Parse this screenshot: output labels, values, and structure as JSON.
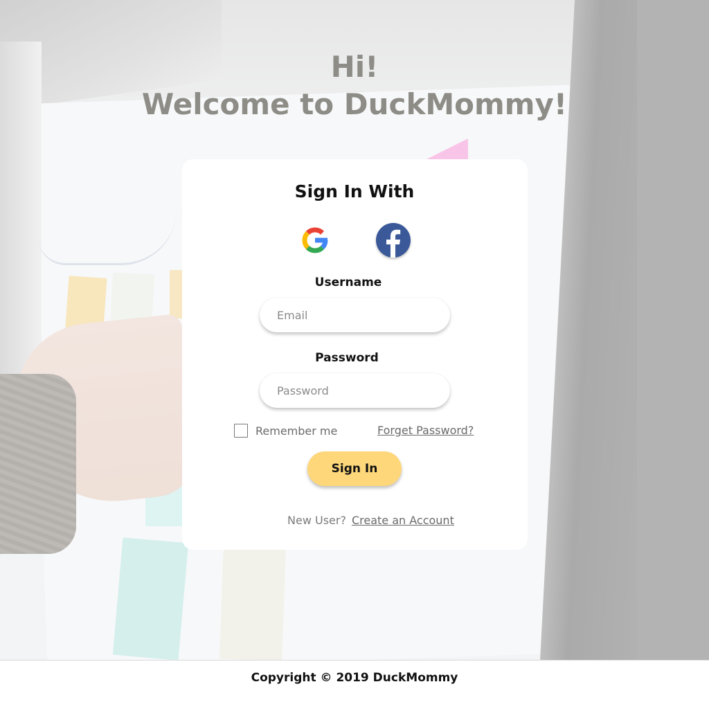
{
  "headline": {
    "line1": "Hi!",
    "line2": "Welcome to DuckMommy!"
  },
  "card": {
    "title": "Sign In With",
    "social": [
      {
        "name": "Google",
        "icon": "google-icon"
      },
      {
        "name": "Facebook",
        "icon": "facebook-icon",
        "color": "#3b5998"
      }
    ],
    "username_label": "Username",
    "email_placeholder": "Email",
    "password_label": "Password",
    "password_placeholder": "Password",
    "remember_label": "Remember me",
    "remember_checked": false,
    "forgot_label": "Forget Password?",
    "signin_label": "Sign In",
    "new_user_text": "New User?",
    "create_account_label": "Create an Account"
  },
  "footer": {
    "copyright": "Copyright © 2019 DuckMommy"
  },
  "colors": {
    "accent_button": "#fdd77a",
    "headline_text": "#8e8c86",
    "facebook_blue": "#3b5998"
  }
}
